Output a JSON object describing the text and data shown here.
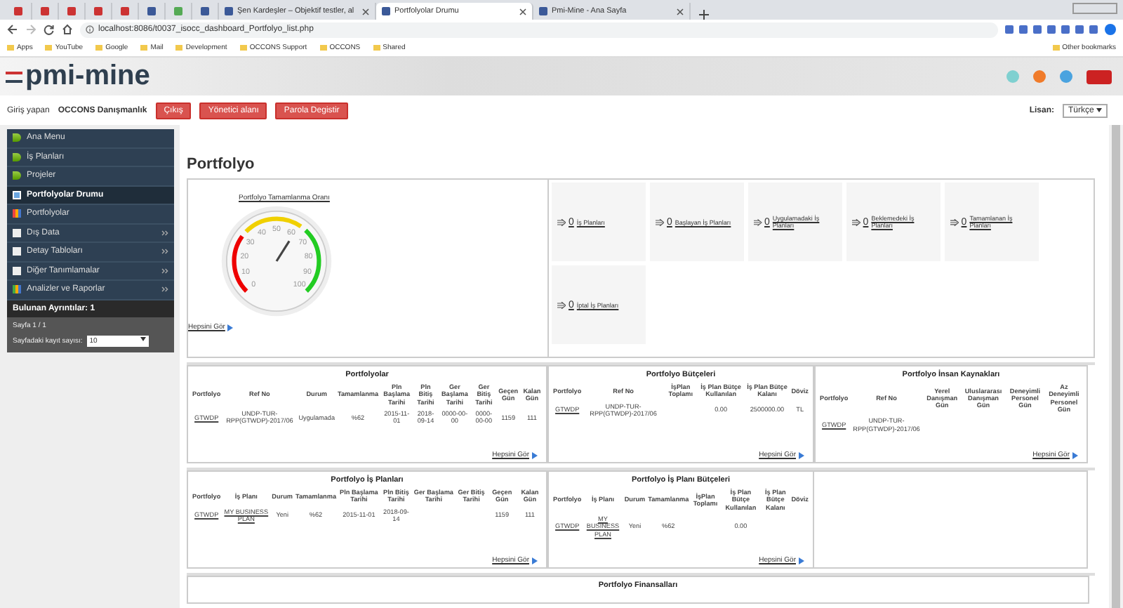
{
  "browser": {
    "tabs": [
      {
        "title": "Şen Kardeşler – Objektif testler, al",
        "selected": false
      },
      {
        "title": "Portfolyolar Drumu",
        "selected": true
      },
      {
        "title": "Pmi-Mine - Ana Sayfa",
        "selected": false
      }
    ],
    "address": "localhost:8086/t0037_isocc_dashboard_Portfolyo_list.php",
    "bookmarks": [
      "Apps",
      "YouTube",
      "Google",
      "Mail",
      "Development",
      "OCCONS Support",
      "OCCONS",
      "Shared"
    ],
    "other_bookmarks": "Other bookmarks"
  },
  "header": {
    "logo": "pmi-mine"
  },
  "user_bar": {
    "label": "Giriş yapan",
    "user": "OCCONS Danışmanlık",
    "buttons": [
      "Çıkış",
      "Yönetici alanı",
      "Parola Degistir"
    ],
    "language_label": "Lisan:",
    "language": "Türkçe"
  },
  "sidebar": {
    "items": [
      {
        "label": "Ana Menu",
        "kind": "back",
        "selected": false,
        "expandable": false
      },
      {
        "label": "İş Planları",
        "kind": "back",
        "selected": false,
        "expandable": false
      },
      {
        "label": "Projeler",
        "kind": "back",
        "selected": false,
        "expandable": false
      },
      {
        "label": "Portfolyolar Drumu",
        "kind": "grid",
        "selected": true,
        "expandable": false
      },
      {
        "label": "Portfolyolar",
        "kind": "bars",
        "selected": false,
        "expandable": false
      },
      {
        "label": "Dış Data",
        "kind": "page",
        "selected": false,
        "expandable": true
      },
      {
        "label": "Detay Tabloları",
        "kind": "page",
        "selected": false,
        "expandable": true
      },
      {
        "label": "Diğer Tanımlamalar",
        "kind": "page",
        "selected": false,
        "expandable": true
      },
      {
        "label": "Analizler ve Raporlar",
        "kind": "chart",
        "selected": false,
        "expandable": true
      }
    ],
    "found": "Bulunan Ayrıntılar: 1",
    "page": "Sayfa 1 / 1",
    "per_page_label": "Sayfadaki kayıt sayısı:",
    "per_page": "10"
  },
  "main": {
    "title": "Portfolyo",
    "gauge": {
      "title": "Portfolyo Tamamlanma Oranı",
      "level": 0.62,
      "ticks": [
        "0",
        "10",
        "20",
        "30",
        "40",
        "50",
        "60",
        "70",
        "80",
        "90",
        "100"
      ],
      "link": "Hepsini Gör"
    },
    "stats": [
      {
        "count": "0",
        "label": "İş Planları"
      },
      {
        "count": "0",
        "label": "Başlayan İş Planları"
      },
      {
        "count": "0",
        "label": "Uygulamadaki İş Planları"
      },
      {
        "count": "0",
        "label": "Beklemedeki İş Planları"
      },
      {
        "count": "0",
        "label": "Tamamlanan İş Planları"
      },
      {
        "count": "0",
        "label": "İptal İş Planları"
      }
    ],
    "table_rows": [
      [
        {
          "title": "Portfolyolar",
          "columns": [
            {
              "label": "Portfolyo",
              "kind": "link"
            },
            {
              "label": "Ref No",
              "kind": "text"
            },
            {
              "label": "Durum",
              "kind": "text"
            },
            {
              "label": "Tamamlanma",
              "kind": "text"
            },
            {
              "label": "Pln Başlama Tarihi",
              "kind": "text"
            },
            {
              "label": "Pln Bitiş Tarihi",
              "kind": "text"
            },
            {
              "label": "Ger Başlama Tarihi",
              "kind": "text"
            },
            {
              "label": "Ger Bitiş Tarihi",
              "kind": "text"
            },
            {
              "label": "Geçen Gün",
              "kind": "text"
            },
            {
              "label": "Kalan Gün",
              "kind": "text"
            }
          ],
          "rows": [
            [
              "GTWDP",
              "UNDP-TUR-RPP(GTWDP)-2017/06",
              "Uygulamada",
              "%62",
              "2015-11-01",
              "2018-09-14",
              "0000-00-00",
              "0000-00-00",
              "1159",
              "111"
            ]
          ],
          "link": "Hepsini Gör"
        },
        {
          "title": "Portfolyo Bütçeleri",
          "columns": [
            {
              "label": "Portfolyo",
              "kind": "link"
            },
            {
              "label": "Ref No",
              "kind": "text"
            },
            {
              "label": "İşPlan Toplamı",
              "kind": "text"
            },
            {
              "label": "İş Plan Bütçe Kullanılan",
              "kind": "text"
            },
            {
              "label": "İş Plan Bütçe Kalanı",
              "kind": "text"
            },
            {
              "label": "Döviz",
              "kind": "text"
            }
          ],
          "rows": [
            [
              "GTWDP",
              "UNDP-TUR-RPP(GTWDP)-2017/06",
              null,
              "0.00",
              "2500000.00",
              "TL"
            ]
          ],
          "link": "Hepsini Gör"
        },
        {
          "title": "Portfolyo İnsan Kaynakları",
          "columns": [
            {
              "label": "Portfolyo",
              "kind": "link"
            },
            {
              "label": "Ref No",
              "kind": "text"
            },
            {
              "label": "Yerel Danışman Gün",
              "kind": "text"
            },
            {
              "label": "Uluslararası Danışman Gün",
              "kind": "text"
            },
            {
              "label": "Deneyimli Personel Gün",
              "kind": "text"
            },
            {
              "label": "Az Deneyimli Personel Gün",
              "kind": "text"
            }
          ],
          "rows": [
            [
              "GTWDP",
              "UNDP-TUR-RPP(GTWDP)-2017/06",
              null,
              null,
              null,
              null
            ]
          ],
          "link": "Hepsini Gör"
        }
      ],
      [
        {
          "title": "Portfolyo İş Planları",
          "columns": [
            {
              "label": "Portfolyo",
              "kind": "link"
            },
            {
              "label": "İş Planı",
              "kind": "link"
            },
            {
              "label": "Durum",
              "kind": "text"
            },
            {
              "label": "Tamamlanma",
              "kind": "text"
            },
            {
              "label": "Pln Başlama Tarihi",
              "kind": "text"
            },
            {
              "label": "Pln Bitiş Tarihi",
              "kind": "text"
            },
            {
              "label": "Ger Başlama Tarihi",
              "kind": "text"
            },
            {
              "label": "Ger Bitiş Tarihi",
              "kind": "text"
            },
            {
              "label": "Geçen Gün",
              "kind": "text"
            },
            {
              "label": "Kalan Gün",
              "kind": "text"
            }
          ],
          "rows": [
            [
              "GTWDP",
              "MY BUSINESS PLAN",
              "Yeni",
              "%62",
              "2015-11-01",
              "2018-09-14",
              null,
              null,
              "1159",
              "111"
            ]
          ],
          "link": "Hepsini Gör"
        },
        {
          "title": "Portfolyo İş Planı Bütçeleri",
          "columns": [
            {
              "label": "Portfolyo",
              "kind": "link"
            },
            {
              "label": "İş Planı",
              "kind": "link"
            },
            {
              "label": "Durum",
              "kind": "text"
            },
            {
              "label": "Tamamlanma",
              "kind": "text"
            },
            {
              "label": "İşPlan Toplamı",
              "kind": "text"
            },
            {
              "label": "İş Plan Bütçe Kullanılan",
              "kind": "text"
            },
            {
              "label": "İş Plan Bütçe Kalanı",
              "kind": "text"
            },
            {
              "label": "Döviz",
              "kind": "text"
            }
          ],
          "rows": [
            [
              "GTWDP",
              "MY BUSINESS PLAN",
              "Yeni",
              "%62",
              null,
              "0.00",
              null,
              null
            ]
          ],
          "link": "Hepsini Gör"
        }
      ],
      [
        {
          "title": "Portfolyo Finansalları"
        }
      ]
    ]
  }
}
